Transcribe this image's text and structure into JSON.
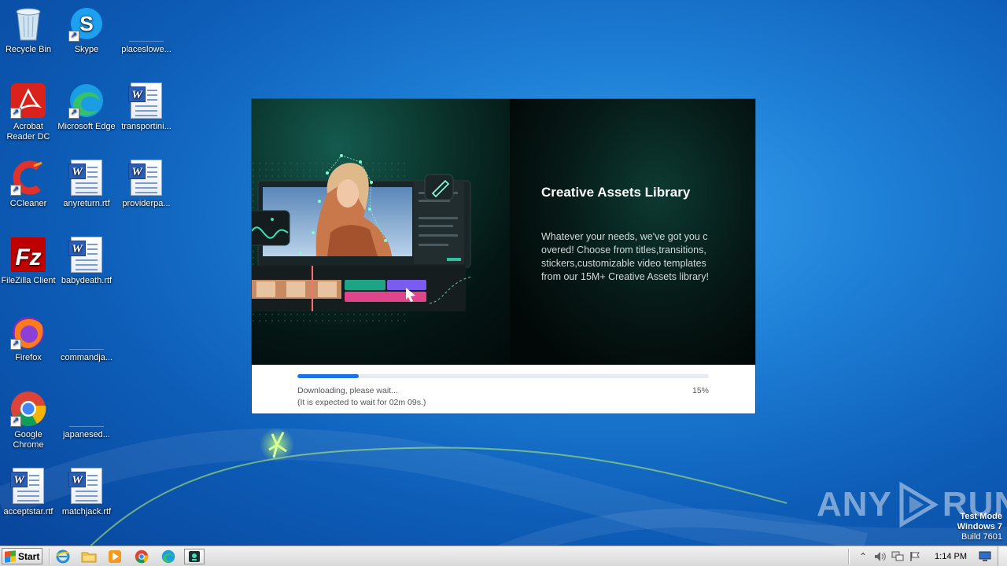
{
  "desktop": {
    "icons": [
      {
        "label": "Recycle Bin",
        "icon": "recycle-bin-icon"
      },
      {
        "label": "Skype",
        "icon": "skype-icon"
      },
      {
        "label": "placeslowe...",
        "icon": "blank-file-icon"
      },
      {
        "label": "Acrobat Reader DC",
        "icon": "acrobat-icon"
      },
      {
        "label": "Microsoft Edge",
        "icon": "edge-icon"
      },
      {
        "label": "transportini...",
        "icon": "word-doc-icon"
      },
      {
        "label": "CCleaner",
        "icon": "ccleaner-icon"
      },
      {
        "label": "anyreturn.rtf",
        "icon": "word-doc-icon"
      },
      {
        "label": "providerpa...",
        "icon": "word-doc-icon"
      },
      {
        "label": "FileZilla Client",
        "icon": "filezilla-icon"
      },
      {
        "label": "babydeath.rtf",
        "icon": "word-doc-icon"
      },
      {
        "label": "Firefox",
        "icon": "firefox-icon"
      },
      {
        "label": "commandja...",
        "icon": "blank-file-icon"
      },
      {
        "label": "Google Chrome",
        "icon": "chrome-icon"
      },
      {
        "label": "japanesed...",
        "icon": "blank-file-icon"
      },
      {
        "label": "acceptstar.rtf",
        "icon": "word-doc-icon"
      },
      {
        "label": "matchjack.rtf",
        "icon": "word-doc-icon"
      }
    ]
  },
  "installer": {
    "banner_title": "Creative Assets Library",
    "banner_description": "Whatever your needs, we've got you covered! Choose from titles,transitions,stickers,customizable video templates from our 15M+ Creative Assets library!",
    "status_line1": "Downloading, please wait...",
    "status_line2": "(It is expected to wait for 02m 09s.)",
    "percent_label": "15%",
    "progress_fraction": 0.15,
    "accent_color": "#1a73e8"
  },
  "watermark": {
    "left": "ANY",
    "right": "RUN"
  },
  "system": {
    "test_mode": "Test Mode",
    "os_name": "Windows 7",
    "build": "Build 7601"
  },
  "taskbar": {
    "start_label": "Start",
    "clock": "1:14 PM",
    "pinned": [
      "internet-explorer-icon",
      "explorer-folder-icon",
      "media-player-icon",
      "chrome-icon",
      "edge-icon",
      "installer-icon"
    ]
  }
}
